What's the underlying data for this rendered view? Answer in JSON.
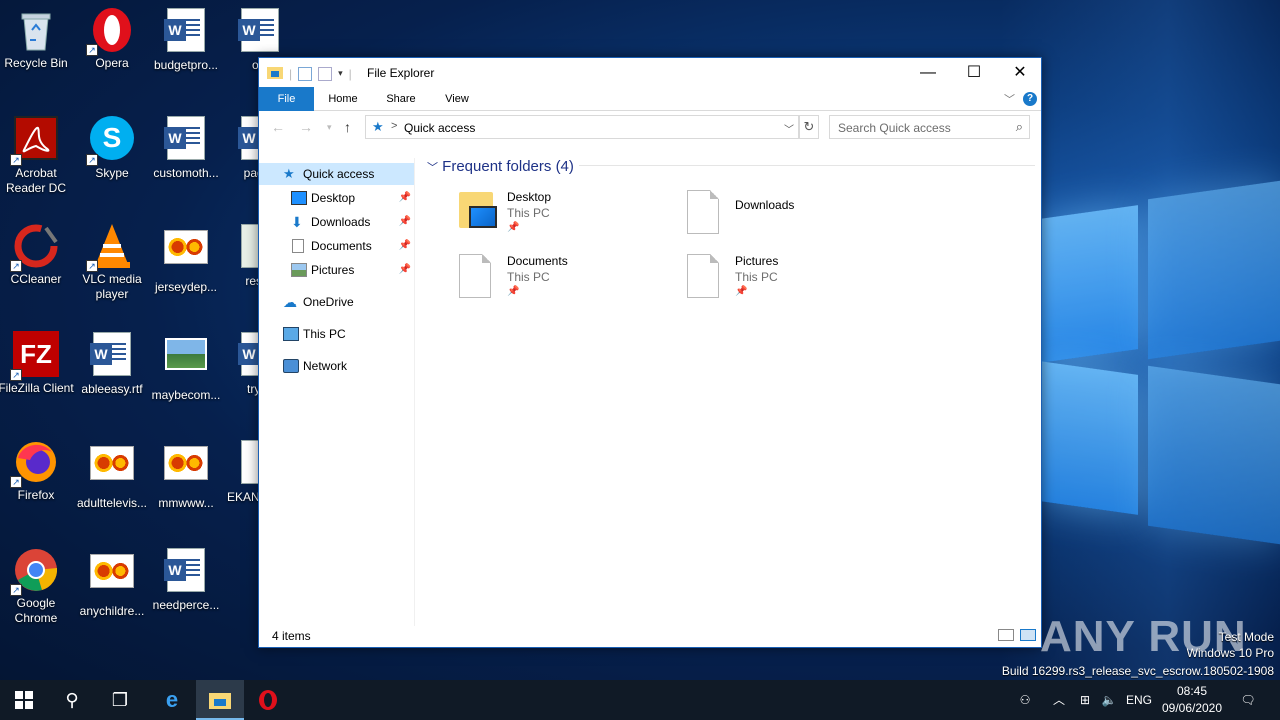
{
  "desktop": {
    "icons": [
      {
        "label": "Recycle Bin"
      },
      {
        "label": "Opera"
      },
      {
        "label": "budgetpro..."
      },
      {
        "label": "ofc"
      },
      {
        "label": "Acrobat Reader DC"
      },
      {
        "label": "Skype"
      },
      {
        "label": "customoth..."
      },
      {
        "label": "pages"
      },
      {
        "label": "CCleaner"
      },
      {
        "label": "VLC media player"
      },
      {
        "label": "jerseydep..."
      },
      {
        "label": "result"
      },
      {
        "label": "FileZilla Client"
      },
      {
        "label": "ableeasy.rtf"
      },
      {
        "label": "maybecom..."
      },
      {
        "label": "tryve"
      },
      {
        "label": "Firefox"
      },
      {
        "label": "adulttelevis..."
      },
      {
        "label": "mmwww..."
      },
      {
        "label": "EKAN ranso"
      },
      {
        "label": "Google Chrome"
      },
      {
        "label": "anychildre..."
      },
      {
        "label": "needperce..."
      }
    ]
  },
  "window": {
    "title": "File Explorer",
    "controls": {
      "minimize": "—",
      "maximize": "☐",
      "close": "✕"
    },
    "ribbon_tabs": {
      "file": "File",
      "home": "Home",
      "share": "Share",
      "view": "View"
    },
    "help": "?",
    "address": {
      "path": "Quick access",
      "separator": ">"
    },
    "search_placeholder": "Search Quick access",
    "nav": {
      "quick_access": "Quick access",
      "desktop": "Desktop",
      "downloads": "Downloads",
      "documents": "Documents",
      "pictures": "Pictures",
      "onedrive": "OneDrive",
      "this_pc": "This PC",
      "network": "Network"
    },
    "content": {
      "group_header": "Frequent folders (4)",
      "tiles": [
        {
          "name": "Desktop",
          "location": "This PC"
        },
        {
          "name": "Downloads",
          "location": ""
        },
        {
          "name": "Documents",
          "location": "This PC"
        },
        {
          "name": "Pictures",
          "location": "This PC"
        }
      ]
    },
    "status": {
      "item_count": "4 items"
    }
  },
  "watermark": {
    "logo": "ANY RUN",
    "mode": "Test Mode",
    "os": "Windows 10 Pro",
    "build": "Build 16299.rs3_release_svc_escrow.180502-1908"
  },
  "taskbar": {
    "tray": {
      "language": "ENG",
      "time": "08:45",
      "date": "09/06/2020"
    }
  },
  "colors": {
    "accent": "#1979ca",
    "taskbar": "#101a26",
    "selection": "#cce8ff",
    "group_header": "#1e3287"
  }
}
